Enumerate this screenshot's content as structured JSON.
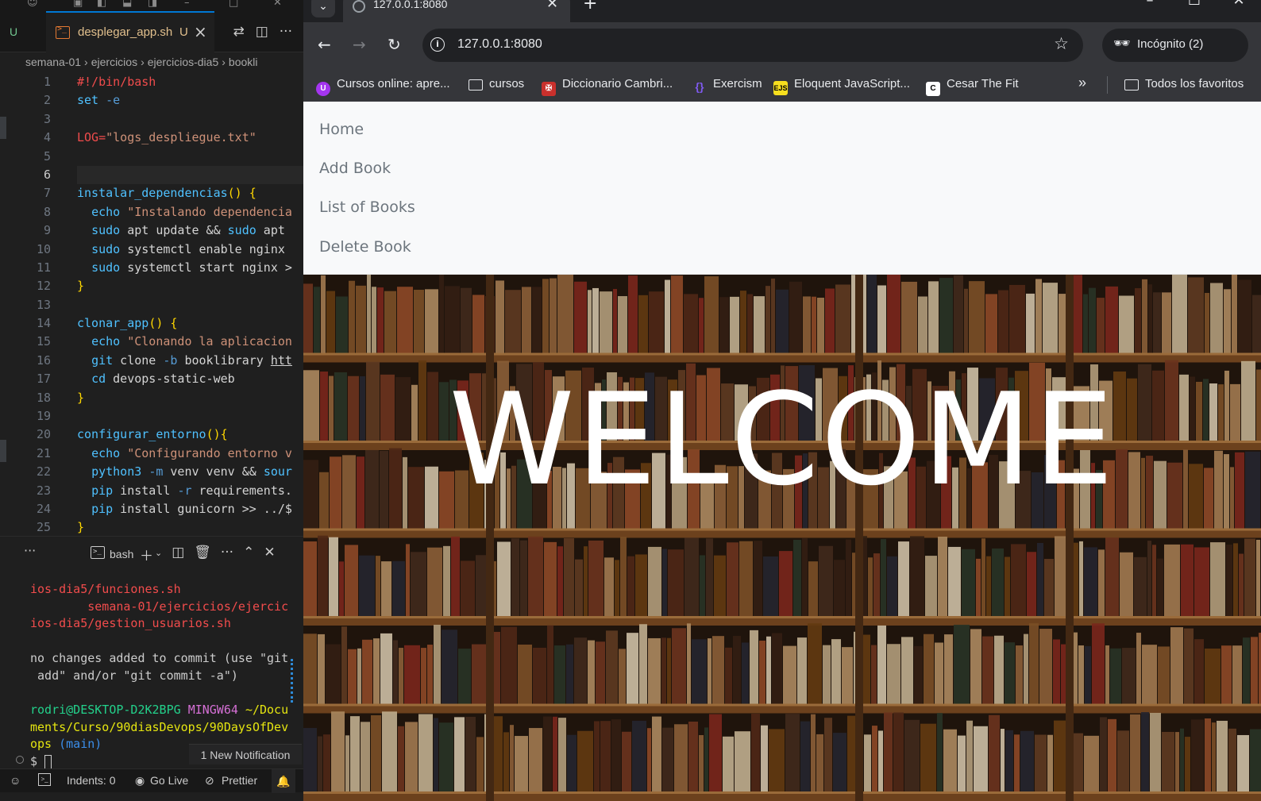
{
  "vscode": {
    "tab_left_status": "U",
    "tab": {
      "name": "desplegar_app.sh",
      "status": "U"
    },
    "breadcrumb": [
      "semana-01",
      "ejercicios",
      "ejercicios-dia5",
      "bookli"
    ],
    "line_numbers": [
      "1",
      "2",
      "3",
      "4",
      "5",
      "6",
      "7",
      "8",
      "9",
      "10",
      "11",
      "12",
      "13",
      "14",
      "15",
      "16",
      "17",
      "18",
      "19",
      "20",
      "21",
      "22",
      "23",
      "24",
      "25"
    ],
    "code": {
      "l1": "#!/bin/bash",
      "l2_cmd": "set",
      "l2_flag": "-e",
      "l4_var": "LOG=",
      "l4_str": "\"logs_despliegue.txt\"",
      "l7_fn": "instalar_dependencias",
      "l7_rest": "() {",
      "l8_cmd": "echo",
      "l8_str": "\"Instalando dependencia",
      "l9_a": "sudo",
      "l9_b": "apt update && ",
      "l9_c": "sudo",
      "l9_d": " apt",
      "l10_a": "sudo",
      "l10_b": " systemctl enable nginx",
      "l11_a": "sudo",
      "l11_b": " systemctl start nginx >",
      "l12": "}",
      "l14_fn": "clonar_app",
      "l14_rest": "() {",
      "l15_cmd": "echo",
      "l15_str": "\"Clonando la aplicacion",
      "l16_cmd": "git",
      "l16_b": " clone ",
      "l16_flag": "-b",
      "l16_c": " booklibrary ",
      "l16_link": "htt",
      "l17_cmd": "cd",
      "l17_b": " devops-static-web",
      "l18": "}",
      "l20_fn": "configurar_entorno",
      "l20_rest": "(){",
      "l21_cmd": "echo",
      "l21_str": "\"Configurando entorno v",
      "l22_cmd": "python3",
      "l22_flag": "-m",
      "l22_b": " venv venv && ",
      "l22_c": "sour",
      "l23_cmd": "pip",
      "l23_b": " install ",
      "l23_flag": "-r",
      "l23_c": " requirements.",
      "l24_cmd": "pip",
      "l24_b": " install gunicorn >> ../$",
      "l25": "}"
    },
    "panel": {
      "terminal_label": "bash"
    },
    "terminal": {
      "line1": "ios-dia5/funciones.sh",
      "line2": "        semana-01/ejercicios/ejercic",
      "line3": "ios-dia5/gestion_usuarios.sh",
      "line4": "no changes added to commit (use \"git",
      "line5": " add\" and/or \"git commit -a\")",
      "prompt_user": "rodri@DESKTOP-D2K2BPG",
      "prompt_env": "MINGW64",
      "prompt_path_1": "~/Docu",
      "prompt_path_2": "ments/Curso/90diasDevops/90DaysOfDev",
      "prompt_path_3": "ops",
      "prompt_branch": "(main)",
      "prompt_symbol": "$"
    },
    "notification": "1 New Notification",
    "statusbar": {
      "indents": "Indents: 0",
      "golive": "Go Live",
      "prettier": "Prettier"
    }
  },
  "chrome": {
    "tab_title": "127.0.0.1:8080",
    "url": "127.0.0.1:8080",
    "incognito": "Incógnito (2)",
    "bookmarks": [
      {
        "label": "Cursos online: apre...",
        "icon": "udemy-icon"
      },
      {
        "label": "cursos",
        "icon": "folder-icon"
      },
      {
        "label": "Diccionario Cambri...",
        "icon": "cambridge-icon"
      },
      {
        "label": "Exercism",
        "icon": "exercism-icon"
      },
      {
        "label": "Eloquent JavaScript...",
        "icon": "ejs-icon"
      },
      {
        "label": "Cesar The Fit",
        "icon": "cesar-icon"
      }
    ],
    "all_bookmarks": "Todos los favoritos"
  },
  "webpage": {
    "nav": [
      "Home",
      "Add Book",
      "List of Books",
      "Delete Book"
    ],
    "hero_title": "WELCOME"
  },
  "colors": {
    "vscode_bg": "#1f1f1f",
    "chrome_toolbar": "#35363a",
    "navbar_bg": "#f8f9fa",
    "nav_link": "#6c757d",
    "accent_blue": "#0078d4"
  }
}
